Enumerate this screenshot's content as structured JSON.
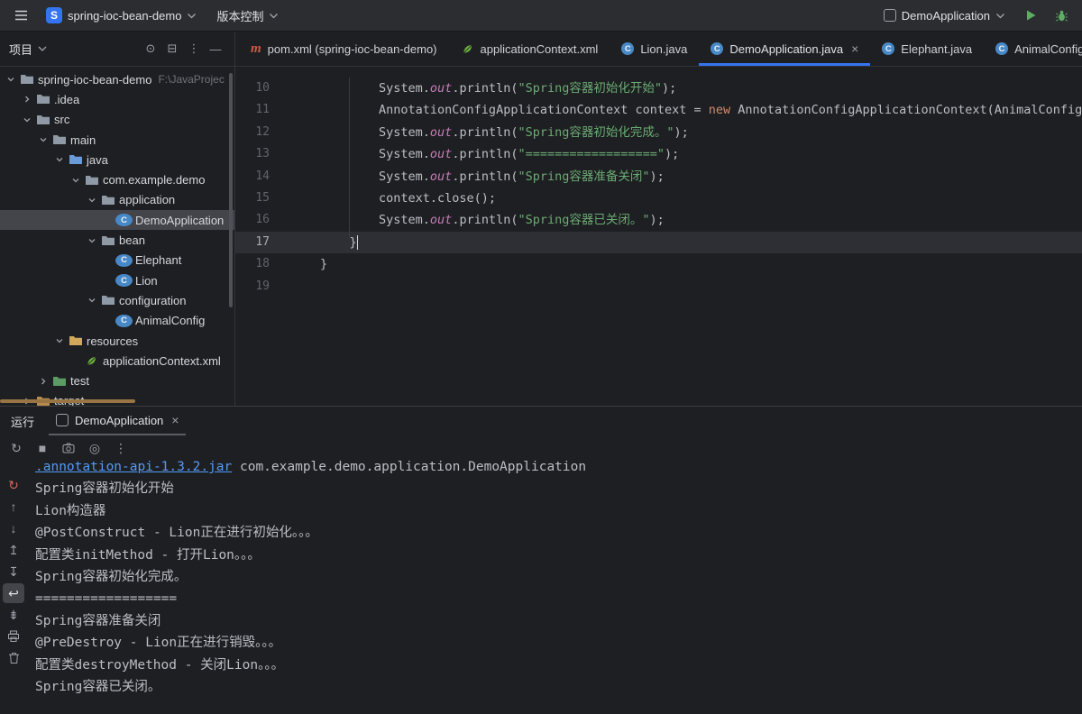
{
  "colors": {
    "accent_blue": "#3574f0",
    "play_green": "#5fad65",
    "string_green": "#6aab73",
    "keyword_orange": "#cf8e6d",
    "field_purple": "#c77dbb",
    "link_blue": "#549af7",
    "maven_red": "#d55844",
    "spring_green": "#6db33f",
    "class_blue": "#4788c7",
    "folder_gray": "#8f9aa6",
    "folder_src_blue": "#6a9bd8",
    "folder_res_gold": "#d2a95c",
    "folder_test_green": "#5c9c64",
    "folder_excluded_orange": "#b98a4e"
  },
  "titlebar": {
    "logo_letter": "S",
    "project_name": "spring-ioc-bean-demo",
    "vcs_label": "版本控制",
    "run_config_name": "DemoApplication"
  },
  "project_panel": {
    "title": "项目",
    "toolbar_icons": [
      "locate-file-icon",
      "collapse-all-icon",
      "more-vertical-icon",
      "hide-panel-icon"
    ],
    "tree": [
      {
        "label": "spring-ioc-bean-demo",
        "suffix": "F:\\JavaProjec",
        "indent": 0,
        "expanded": true,
        "icon": "folder"
      },
      {
        "label": ".idea",
        "indent": 1,
        "expanded": false,
        "icon": "folder"
      },
      {
        "label": "src",
        "indent": 1,
        "expanded": true,
        "icon": "folder"
      },
      {
        "label": "main",
        "indent": 2,
        "expanded": true,
        "icon": "folder"
      },
      {
        "label": "java",
        "indent": 3,
        "expanded": true,
        "icon": "folder-src"
      },
      {
        "label": "com.example.demo",
        "indent": 4,
        "expanded": true,
        "icon": "package"
      },
      {
        "label": "application",
        "indent": 5,
        "expanded": true,
        "icon": "package"
      },
      {
        "label": "DemoApplication",
        "indent": 6,
        "icon": "class",
        "selected": true
      },
      {
        "label": "bean",
        "indent": 5,
        "expanded": true,
        "icon": "package"
      },
      {
        "label": "Elephant",
        "indent": 6,
        "icon": "class"
      },
      {
        "label": "Lion",
        "indent": 6,
        "icon": "class"
      },
      {
        "label": "configuration",
        "indent": 5,
        "expanded": true,
        "icon": "package"
      },
      {
        "label": "AnimalConfig",
        "indent": 6,
        "icon": "class"
      },
      {
        "label": "resources",
        "indent": 3,
        "expanded": true,
        "icon": "folder-res"
      },
      {
        "label": "applicationContext.xml",
        "indent": 4,
        "icon": "spring"
      },
      {
        "label": "test",
        "indent": 2,
        "expanded": false,
        "icon": "folder-test"
      },
      {
        "label": "target",
        "indent": 1,
        "expanded": false,
        "icon": "folder-excluded"
      }
    ]
  },
  "editor": {
    "tabs": [
      {
        "label": "pom.xml (spring-ioc-bean-demo)",
        "icon": "maven"
      },
      {
        "label": "applicationContext.xml",
        "icon": "spring"
      },
      {
        "label": "Lion.java",
        "icon": "class"
      },
      {
        "label": "DemoApplication.java",
        "icon": "class",
        "active": true,
        "close": true
      },
      {
        "label": "Elephant.java",
        "icon": "class"
      },
      {
        "label": "AnimalConfig.java",
        "icon": "class"
      }
    ],
    "code": {
      "active_line": 17,
      "lines": [
        {
          "num": 10,
          "tokens": [
            {
              "t": "plain",
              "v": "        System."
            },
            {
              "t": "field",
              "v": "out"
            },
            {
              "t": "plain",
              "v": ".println("
            },
            {
              "t": "string",
              "v": "\"Spring容器初始化开始\""
            },
            {
              "t": "plain",
              "v": ");"
            }
          ]
        },
        {
          "num": 11,
          "tokens": [
            {
              "t": "plain",
              "v": "        AnnotationConfigApplicationContext context = "
            },
            {
              "t": "keyword",
              "v": "new"
            },
            {
              "t": "plain",
              "v": " AnnotationConfigApplicationContext(AnimalConfig.class);"
            }
          ]
        },
        {
          "num": 12,
          "tokens": [
            {
              "t": "plain",
              "v": "        System."
            },
            {
              "t": "field",
              "v": "out"
            },
            {
              "t": "plain",
              "v": ".println("
            },
            {
              "t": "string",
              "v": "\"Spring容器初始化完成。\""
            },
            {
              "t": "plain",
              "v": ");"
            }
          ]
        },
        {
          "num": 13,
          "tokens": [
            {
              "t": "plain",
              "v": "        System."
            },
            {
              "t": "field",
              "v": "out"
            },
            {
              "t": "plain",
              "v": ".println("
            },
            {
              "t": "string",
              "v": "\"==================\""
            },
            {
              "t": "plain",
              "v": ");"
            }
          ]
        },
        {
          "num": 14,
          "tokens": [
            {
              "t": "plain",
              "v": "        System."
            },
            {
              "t": "field",
              "v": "out"
            },
            {
              "t": "plain",
              "v": ".println("
            },
            {
              "t": "string",
              "v": "\"Spring容器准备关闭\""
            },
            {
              "t": "plain",
              "v": ");"
            }
          ]
        },
        {
          "num": 15,
          "tokens": [
            {
              "t": "plain",
              "v": "        context.close();"
            }
          ]
        },
        {
          "num": 16,
          "tokens": [
            {
              "t": "plain",
              "v": "        System."
            },
            {
              "t": "field",
              "v": "out"
            },
            {
              "t": "plain",
              "v": ".println("
            },
            {
              "t": "string",
              "v": "\"Spring容器已关闭。\""
            },
            {
              "t": "plain",
              "v": ");"
            }
          ]
        },
        {
          "num": 17,
          "tokens": [
            {
              "t": "plain",
              "v": "    }"
            }
          ]
        },
        {
          "num": 18,
          "tokens": [
            {
              "t": "plain",
              "v": "}"
            }
          ]
        },
        {
          "num": 19,
          "tokens": []
        }
      ]
    }
  },
  "run_panel": {
    "title": "运行",
    "tab_label": "DemoApplication",
    "toolbar_icons": [
      {
        "name": "rerun-icon"
      },
      {
        "name": "stop-icon"
      },
      {
        "name": "thread-dump-icon"
      },
      {
        "name": "console-settings-icon"
      },
      {
        "name": "more-vertical-icon"
      }
    ],
    "gutter_icons": [
      {
        "name": "rerun-icon",
        "style": "rerun"
      },
      {
        "name": "up-the-stack-trace-icon"
      },
      {
        "name": "down-the-stack-trace-icon"
      },
      {
        "name": "prev-message-icon"
      },
      {
        "name": "next-message-icon"
      },
      {
        "name": "soft-wrap-icon",
        "selected": true
      },
      {
        "name": "scroll-to-end-icon"
      },
      {
        "name": "print-icon"
      },
      {
        "name": "clear-all-icon"
      }
    ],
    "console_lines": [
      {
        "segments": [
          {
            "t": "link",
            "v": ".annotation-api-1.3.2.jar"
          },
          {
            "t": "plain",
            "v": " com.example.demo.application.DemoApplication"
          }
        ]
      },
      {
        "segments": [
          {
            "t": "plain",
            "v": "Spring容器初始化开始"
          }
        ]
      },
      {
        "segments": [
          {
            "t": "plain",
            "v": "Lion构造器"
          }
        ]
      },
      {
        "segments": [
          {
            "t": "plain",
            "v": "@PostConstruct - Lion正在进行初始化。。。"
          }
        ]
      },
      {
        "segments": [
          {
            "t": "plain",
            "v": "配置类initMethod - 打开Lion。。。"
          }
        ]
      },
      {
        "segments": [
          {
            "t": "plain",
            "v": "Spring容器初始化完成。"
          }
        ]
      },
      {
        "segments": [
          {
            "t": "plain",
            "v": "=================="
          }
        ]
      },
      {
        "segments": [
          {
            "t": "plain",
            "v": "Spring容器准备关闭"
          }
        ]
      },
      {
        "segments": [
          {
            "t": "plain",
            "v": "@PreDestroy - Lion正在进行销毁。。。"
          }
        ]
      },
      {
        "segments": [
          {
            "t": "plain",
            "v": "配置类destroyMethod - 关闭Lion。。。"
          }
        ]
      },
      {
        "segments": [
          {
            "t": "plain",
            "v": "Spring容器已关闭。"
          }
        ]
      }
    ]
  }
}
